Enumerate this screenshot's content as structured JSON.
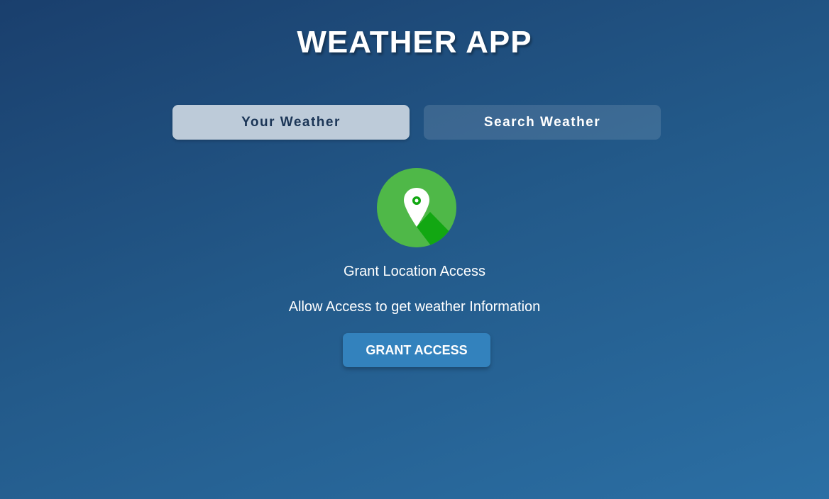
{
  "app": {
    "title": "WEATHER APP"
  },
  "tabs": [
    {
      "label": "Your Weather",
      "active": true
    },
    {
      "label": "Search Weather",
      "active": false
    }
  ],
  "grant_location": {
    "icon": "location-pin-icon",
    "title": "Grant Location Access",
    "description": "Allow Access to get weather Information",
    "button_label": "GRANT ACCESS"
  },
  "colors": {
    "background_start": "#1a3f6d",
    "background_end": "#2b6fa4",
    "tab_active_bg": "#bdcbd9",
    "tab_active_text": "#1b3556",
    "button_bg": "#3382bd",
    "icon_circle": "#4fb848",
    "icon_shadow": "#12a712"
  }
}
